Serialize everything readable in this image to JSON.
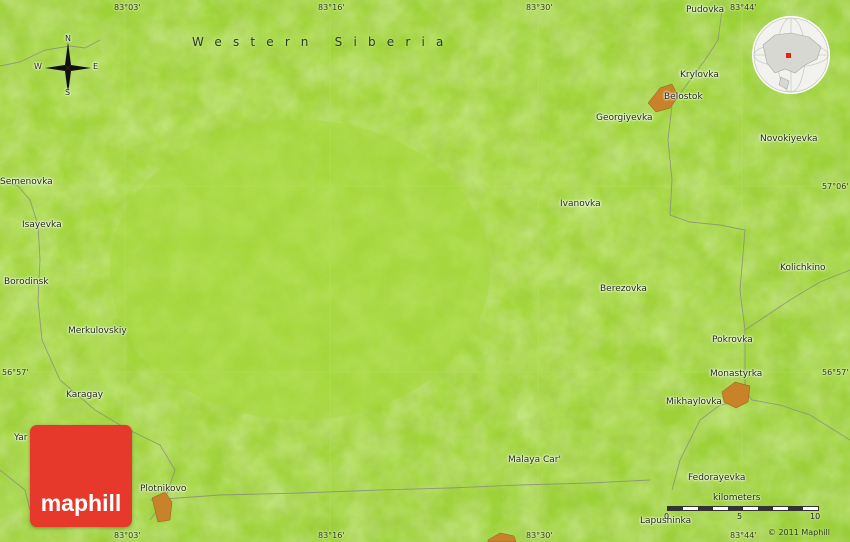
{
  "map": {
    "region_label": "Western Siberia",
    "provider": "maphill",
    "copyright": "© 2011 Maphill",
    "colors": {
      "land": "#a2d63a",
      "settlement": "#c8822a",
      "logo": "#e6392b"
    },
    "compass": {
      "n": "N",
      "s": "S",
      "e": "E",
      "w": "W"
    },
    "scale": {
      "title": "kilometers",
      "ticks": [
        "0",
        "5",
        "10"
      ]
    },
    "coords": {
      "top": [
        "83°03'",
        "83°16'",
        "83°30'",
        "83°44'"
      ],
      "bottom": [
        "83°03'",
        "83°16'",
        "83°30'",
        "83°44'"
      ],
      "left": [
        "56°57'"
      ],
      "right": [
        "57°06'",
        "56°57'"
      ]
    },
    "places": [
      "Pudovka",
      "Krylovka",
      "Belostok",
      "Georgiyevka",
      "Novokiyevka",
      "Semenovka",
      "Isayevka",
      "Ivanovka",
      "Borodinsk",
      "Kolichkino",
      "Berezovka",
      "Merkulovskiy",
      "Pokrovka",
      "Monastyrka",
      "Karagay",
      "Mikhaylovka",
      "Yar",
      "Malaya Car'",
      "Fedorayevka",
      "Plotnikovo",
      "Lapushinka"
    ]
  }
}
